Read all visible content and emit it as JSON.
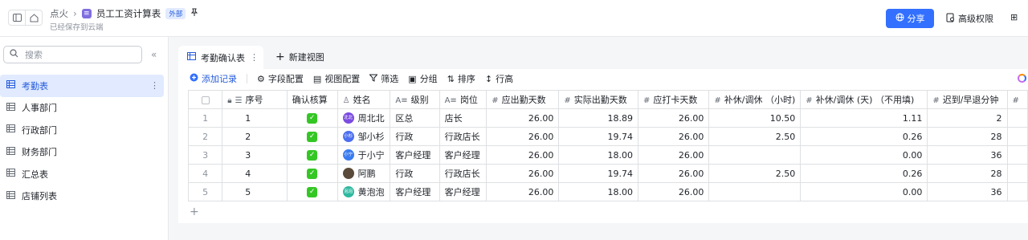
{
  "header": {
    "breadcrumb_root": "点火",
    "doc_title": "员工工资计算表",
    "external_badge": "外部",
    "saved_status": "已经保存到云端",
    "share_label": "分享",
    "permission_label": "高级权限",
    "bot_label": "⊞",
    "doc_icon_char": "≡"
  },
  "sidebar": {
    "search_placeholder": "搜索",
    "items": [
      {
        "label": "考勤表"
      },
      {
        "label": "人事部门"
      },
      {
        "label": "行政部门"
      },
      {
        "label": "财务部门"
      },
      {
        "label": "汇总表"
      },
      {
        "label": "店铺列表"
      }
    ]
  },
  "tabs": {
    "active_label": "考勤确认表",
    "new_view_label": "新建视图"
  },
  "toolbar": {
    "add_record": "添加记录",
    "field_config": "字段配置",
    "view_config": "视图配置",
    "filter": "筛选",
    "group": "分组",
    "sort": "排序",
    "row_height": "行高"
  },
  "table": {
    "columns": [
      "序号",
      "确认核算",
      "姓名",
      "级别",
      "岗位",
      "应出勤天数",
      "实际出勤天数",
      "应打卡天数",
      "补休/调休 （小时)",
      "补休/调休 (天) （不用填)",
      "迟到/早退分钟"
    ],
    "rows": [
      {
        "idx": "1",
        "seq": "1",
        "name": "周北北",
        "avatar_text": "北北",
        "avatar_color": "#7b4ce0",
        "level": "区总",
        "post": "店长",
        "due": "26.00",
        "actual": "18.89",
        "clock": "26.00",
        "comp_h": "10.50",
        "comp_d": "1.11",
        "late": "2"
      },
      {
        "idx": "2",
        "seq": "2",
        "name": "邹小杉",
        "avatar_text": "小杉",
        "avatar_color": "#4c6ef0",
        "level": "行政",
        "post": "行政店长",
        "due": "26.00",
        "actual": "19.74",
        "clock": "26.00",
        "comp_h": "2.50",
        "comp_d": "0.26",
        "late": "28"
      },
      {
        "idx": "3",
        "seq": "3",
        "name": "于小宁",
        "avatar_text": "小宁",
        "avatar_color": "#3a7bf0",
        "level": "客户经理",
        "post": "客户经理",
        "due": "26.00",
        "actual": "18.00",
        "clock": "26.00",
        "comp_h": "",
        "comp_d": "0.00",
        "late": "36"
      },
      {
        "idx": "4",
        "seq": "4",
        "name": "阿鹏",
        "avatar_text": "",
        "avatar_color": "#5a4a3a",
        "level": "行政",
        "post": "行政店长",
        "due": "26.00",
        "actual": "19.74",
        "clock": "26.00",
        "comp_h": "2.50",
        "comp_d": "0.26",
        "late": "28"
      },
      {
        "idx": "5",
        "seq": "5",
        "name": "黄泡泡",
        "avatar_text": "泡泡",
        "avatar_color": "#2fb8a0",
        "level": "客户经理",
        "post": "客户经理",
        "due": "26.00",
        "actual": "18.00",
        "clock": "26.00",
        "comp_h": "",
        "comp_d": "0.00",
        "late": "36"
      }
    ]
  }
}
